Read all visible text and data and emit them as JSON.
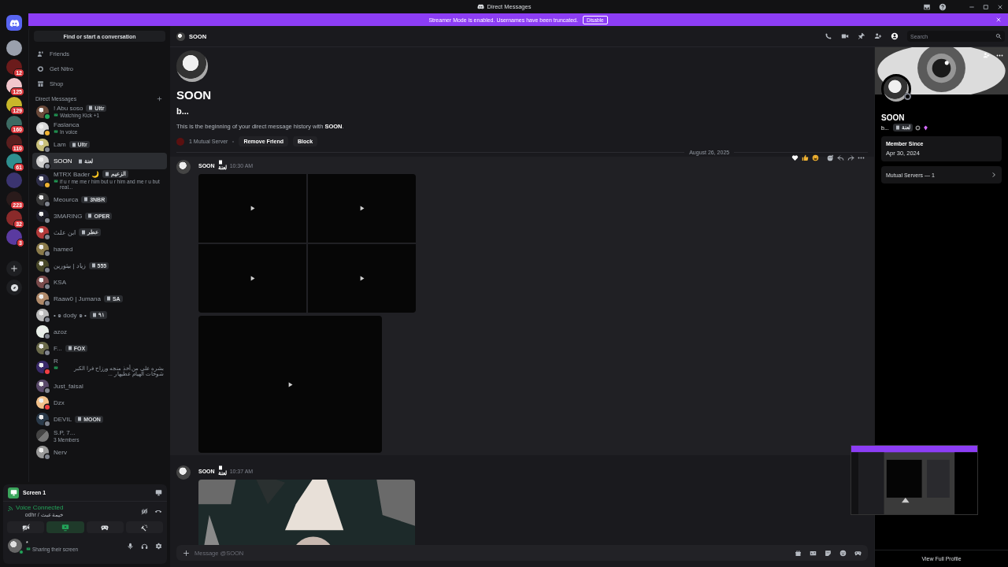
{
  "window": {
    "title": "Direct Messages"
  },
  "banner": {
    "text": "Streamer Mode is enabled. Usernames have been truncated.",
    "button": "Disable"
  },
  "servers": [
    {
      "kind": "home",
      "selected": true
    },
    {
      "kind": "server",
      "selected": false,
      "color": "#9aa0ad"
    },
    {
      "kind": "server",
      "selected": false,
      "color": "#6b1b1b",
      "badge": "12"
    },
    {
      "kind": "server",
      "selected": false,
      "color": "#f2c6cc",
      "badge": "125"
    },
    {
      "kind": "server",
      "selected": false,
      "color": "#c8b72a",
      "badge": "129"
    },
    {
      "kind": "server",
      "selected": false,
      "color": "#3d6b63",
      "badge": "160"
    },
    {
      "kind": "server",
      "selected": false,
      "color": "#5a1e1e",
      "badge": "110"
    },
    {
      "kind": "server",
      "selected": false,
      "color": "#2f8f8f",
      "badge": "61"
    },
    {
      "kind": "server",
      "selected": false,
      "color": "#3b3470"
    },
    {
      "kind": "server",
      "selected": false,
      "color": "#2a1b1b",
      "badge": "223"
    },
    {
      "kind": "server",
      "selected": false,
      "color": "#8a2a2a",
      "badge": "32"
    },
    {
      "kind": "server",
      "selected": false,
      "color": "#5a3aa0",
      "badge": "3"
    },
    {
      "kind": "add",
      "selected": false
    },
    {
      "kind": "discover",
      "selected": false
    }
  ],
  "sidebar": {
    "search_button": "Find or start a conversation",
    "nav": [
      {
        "kind": "friends",
        "label": "Friends"
      },
      {
        "kind": "nitro",
        "label": "Get Nitro"
      },
      {
        "kind": "shop",
        "label": "Shop"
      }
    ],
    "section_title": "Direct Messages",
    "dms": [
      {
        "name": "! Abu soso",
        "tag": "Ultr",
        "activity": "Watching Kick +1",
        "activity_icon": true,
        "color": "#23a55a",
        "selected": false
      },
      {
        "name": "Faslanca",
        "activity": "In voice",
        "activity_icon": true,
        "color": "#f0b232",
        "selected": false
      },
      {
        "name": "Lam",
        "tag": "Ultr",
        "color": "#80848e",
        "selected": false
      },
      {
        "name": "SOON",
        "tag": "لعنة",
        "color": "#80848e",
        "selected": true
      },
      {
        "name": "MTRX Bader 🌙",
        "tag": "الزعيم",
        "activity": "if u r me me r him but u r him and me r u but real...",
        "activity_icon": true,
        "color": "#f0b232",
        "selected": false
      },
      {
        "name": "Meourca",
        "tag": "3NBR",
        "color": "#80848e",
        "selected": false
      },
      {
        "name": "3MARING",
        "tag": "OPER",
        "color": "#80848e",
        "selected": false
      },
      {
        "name": "ابن علث",
        "tag": "عطر",
        "color": "#80848e",
        "selected": false
      },
      {
        "name": "hamed",
        "color": "#80848e",
        "selected": false
      },
      {
        "name": "زياد | بيثورين",
        "tag": "555",
        "color": "#80848e",
        "selected": false
      },
      {
        "name": "KSA",
        "color": "#80848e",
        "selected": false
      },
      {
        "name": "Raaw0 | Jumana",
        "tag": "SA",
        "color": "#80848e",
        "selected": false
      },
      {
        "name": "• ๑ dody ๑ •",
        "tag": "٩١",
        "color": "#80848e",
        "selected": false
      },
      {
        "name": "azoz",
        "color": "#80848e",
        "selected": false
      },
      {
        "name": "F...",
        "tag": "FOX",
        "color": "#80848e",
        "selected": false
      },
      {
        "name": "R",
        "activity": "بشره على من أخذ منجه ورزاح فرا الكبر شوخات الهيام عطيها ر ...",
        "activity_icon": true,
        "color": "#f23f43",
        "selected": false
      },
      {
        "name": "Just_faisal",
        "color": "#80848e",
        "selected": false
      },
      {
        "name": "Dzx",
        "color": "#f23f43",
        "selected": false
      },
      {
        "name": "DEVIL",
        "tag": "MOON",
        "color": "#80848e",
        "selected": false
      },
      {
        "name": "S.P, 7...",
        "activity": "3 Members",
        "selected": false
      },
      {
        "name": "Nerv",
        "color": "#80848e",
        "selected": false
      }
    ]
  },
  "voice": {
    "stream_title": "Screen 1",
    "status": "Voice Connected",
    "channel": "خيمة عبث / odhr",
    "controls": [
      {
        "kind": "camera",
        "selected": false
      },
      {
        "kind": "screen",
        "selected": true
      },
      {
        "kind": "activity",
        "selected": false
      },
      {
        "kind": "soundboard",
        "selected": false
      }
    ]
  },
  "user": {
    "name": "*",
    "status": "Sharing their screen"
  },
  "chat": {
    "recipient": "SOON",
    "search_placeholder": "Search",
    "intro": {
      "name": "SOON",
      "subtitle": "b...",
      "text": "This is the beginning of your direct message history with **SOON**.",
      "mutual": "1 Mutual Server",
      "buttons": [
        "Remove Friend",
        "Block"
      ]
    },
    "date_divider": "August 26, 2025",
    "messages": [
      {
        "author": "SOON",
        "tag": "لعنة",
        "time": "10:30 AM",
        "hovered": true,
        "attachments": [
          {
            "kind": "mosaic",
            "items": [
              {
                "kind": "video"
              },
              {
                "kind": "video"
              },
              {
                "kind": "video"
              },
              {
                "kind": "video"
              }
            ]
          },
          {
            "kind": "video"
          }
        ]
      },
      {
        "author": "SOON",
        "tag": "لعنة",
        "time": "10:37 AM",
        "hovered": false
      }
    ],
    "composer_placeholder": "Message @SOON"
  },
  "profile": {
    "name": "SOON",
    "subtitle": "b...",
    "tag": "لعنة",
    "member_since_label": "Member Since",
    "member_since": "Apr 30, 2024",
    "mutual_servers": "Mutual Servers — 1",
    "footer_button": "View Full Profile"
  }
}
